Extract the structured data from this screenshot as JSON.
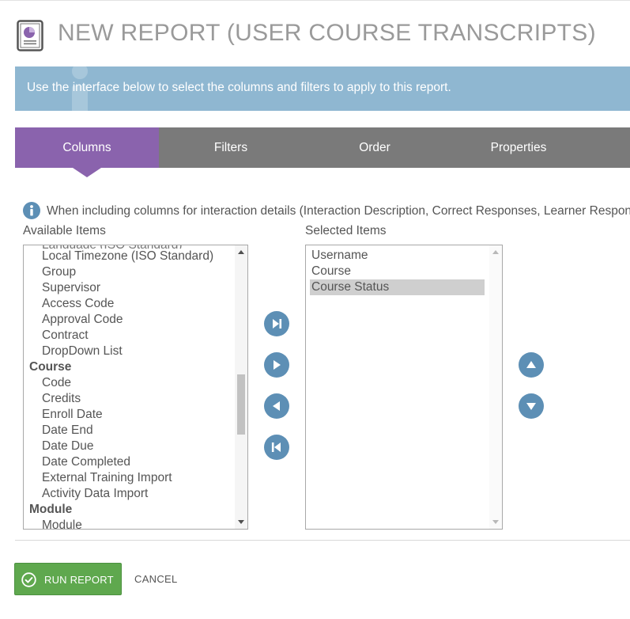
{
  "header": {
    "title": "NEW REPORT (USER COURSE TRANSCRIPTS)",
    "icon": "report-pie-chart-icon"
  },
  "banner": {
    "text": "Use the interface below to select the columns and filters to apply to this report."
  },
  "tabs": [
    {
      "label": "Columns",
      "active": true
    },
    {
      "label": "Filters",
      "active": false
    },
    {
      "label": "Order",
      "active": false
    },
    {
      "label": "Properties",
      "active": false
    }
  ],
  "notice": {
    "text": "When including columns for interaction details (Interaction Description, Correct Responses, Learner Response, Result)"
  },
  "available": {
    "label": "Available Items",
    "items": [
      {
        "text": "Language (ISO Standard)",
        "type": "item",
        "cut": true
      },
      {
        "text": "Local Timezone (ISO Standard)",
        "type": "item"
      },
      {
        "text": "Group",
        "type": "item"
      },
      {
        "text": "Supervisor",
        "type": "item"
      },
      {
        "text": "Access Code",
        "type": "item"
      },
      {
        "text": "Approval Code",
        "type": "item"
      },
      {
        "text": "Contract",
        "type": "item"
      },
      {
        "text": "DropDown List",
        "type": "item"
      },
      {
        "text": "Course",
        "type": "group"
      },
      {
        "text": "Code",
        "type": "item"
      },
      {
        "text": "Credits",
        "type": "item"
      },
      {
        "text": "Enroll Date",
        "type": "item"
      },
      {
        "text": "Date End",
        "type": "item"
      },
      {
        "text": "Date Due",
        "type": "item"
      },
      {
        "text": "Date Completed",
        "type": "item"
      },
      {
        "text": "External Training Import",
        "type": "item"
      },
      {
        "text": "Activity Data Import",
        "type": "item"
      },
      {
        "text": "Module",
        "type": "group"
      },
      {
        "text": "Module",
        "type": "item"
      }
    ]
  },
  "selected": {
    "label": "Selected Items",
    "items": [
      {
        "text": "Username",
        "selected": false
      },
      {
        "text": "Course",
        "selected": false
      },
      {
        "text": "Course Status",
        "selected": true
      }
    ]
  },
  "buttons": {
    "add_all": "skip-forward-icon",
    "add": "play-right-icon",
    "remove": "play-left-icon",
    "remove_all": "skip-back-icon",
    "move_up": "triangle-up-icon",
    "move_down": "triangle-down-icon"
  },
  "footer": {
    "run_label": "RUN REPORT",
    "cancel_label": "CANCEL"
  },
  "colors": {
    "accent_tab": "#8a63ad",
    "tab_bar": "#7a7a7a",
    "banner": "#8fb7d1",
    "round_button": "#5d8fb5",
    "run_button": "#5fa84e"
  }
}
